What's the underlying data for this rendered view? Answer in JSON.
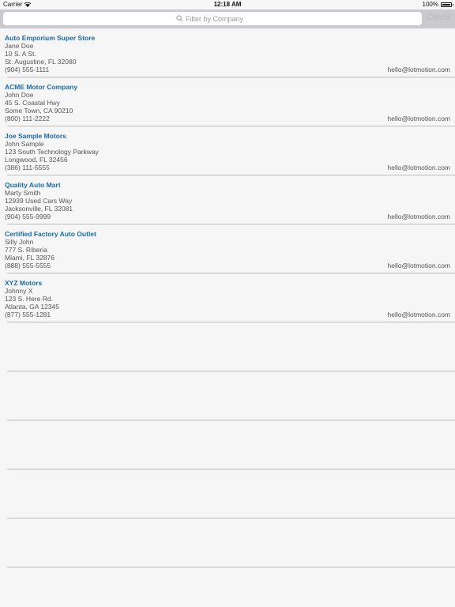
{
  "status": {
    "carrier": "Carrier",
    "time": "12:18 AM",
    "battery": "100%",
    "battery_level": 1.0
  },
  "search": {
    "placeholder": "Filter by Company",
    "cancel_label": "Cancel"
  },
  "dealers": [
    {
      "company": "Auto Emporium Super Store",
      "contact": "Jane Doe",
      "street": "10 S. A St.",
      "city": "St. Augustine, FL 32080",
      "phone": "(904) 555-1111",
      "email": "hello@lotmotion.com"
    },
    {
      "company": "ACME Motor Company",
      "contact": "John Doe",
      "street": "45 S. Coastal Hwy",
      "city": "Some Town, CA 90210",
      "phone": "(800) 111-2222",
      "email": "hello@lotmotion.com"
    },
    {
      "company": "Joe Sample Motors",
      "contact": "John Sample",
      "street": "123 South Technology Parkway",
      "city": "Longwood, FL 32456",
      "phone": "(386) 111-5555",
      "email": "hello@lotmotion.com"
    },
    {
      "company": "Quality Auto Mart",
      "contact": "Marty Smith",
      "street": "12939 Used Cars Way",
      "city": "Jacksonville, FL 32081",
      "phone": "(904) 555-9999",
      "email": "hello@lotmotion.com"
    },
    {
      "company": "Certified Factory Auto Outlet",
      "contact": "Silly John",
      "street": "777 S. Riberia",
      "city": "Miami, FL 32876",
      "phone": "(888) 555-5555",
      "email": "hello@lotmotion.com"
    },
    {
      "company": "XYZ Motors",
      "contact": "Johnny X",
      "street": "123 S. Here Rd.",
      "city": "Atlanta, GA 12345",
      "phone": "(877) 555-1281",
      "email": "hello@lotmotion.com"
    }
  ]
}
